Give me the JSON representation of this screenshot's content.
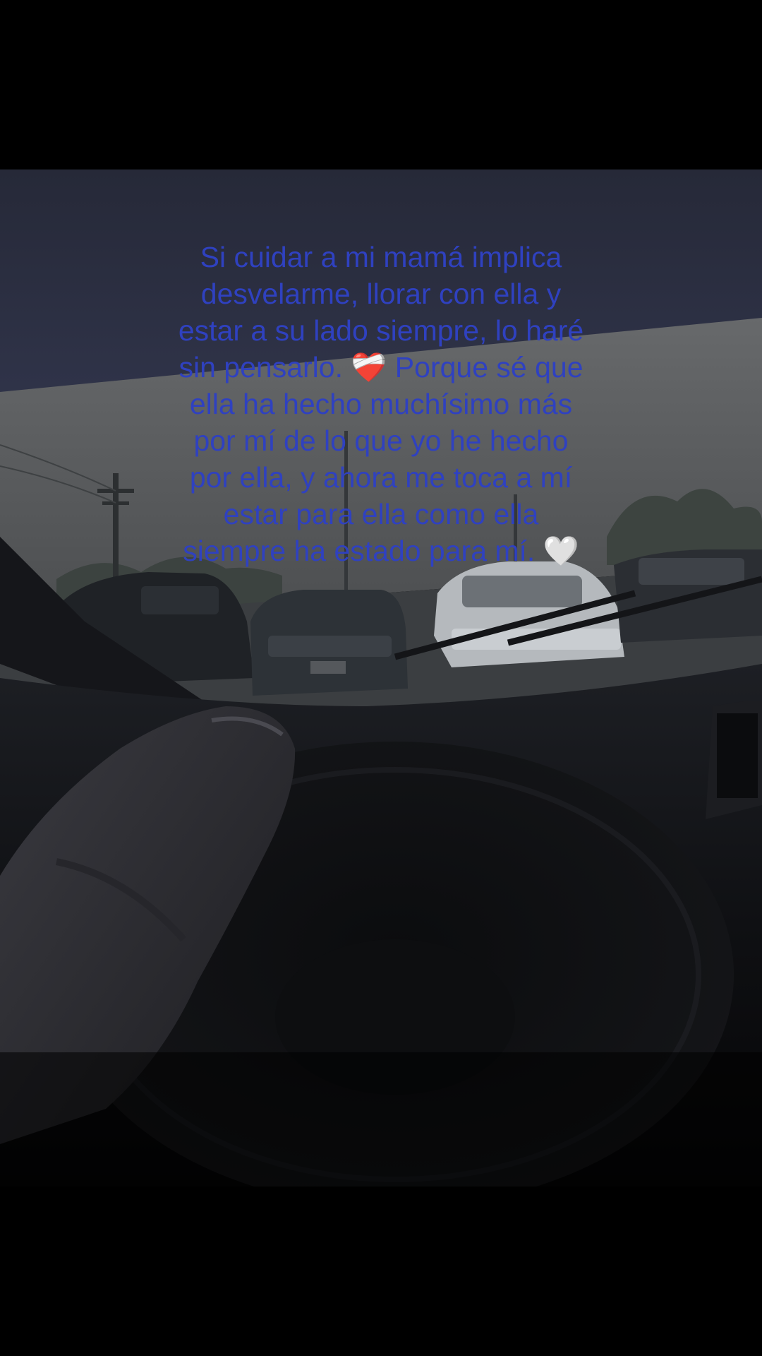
{
  "story": {
    "caption_text": "Si cuidar a mi mamá implica desvelarme, llorar con ella y estar a su lado siempre, lo haré sin pensarlo. ❤️‍🩹 Porque sé que ella ha hecho muchísimo más por mí de lo que yo he hecho por ella, y ahora me toca a mí estar para ella como ella siempre ha estado para mí. 🤍",
    "text_color": "#2f41c0",
    "emojis": [
      "mending-heart-emoji",
      "white-heart-emoji"
    ]
  },
  "photo": {
    "subject": "car interior with steering wheel and arm, parking lot with cars under overcast sky",
    "palette": {
      "sky": "#5a5f63",
      "headliner": "#2a2d3d",
      "dashboard": "#111317",
      "sleeve": "#2b2b30"
    }
  }
}
